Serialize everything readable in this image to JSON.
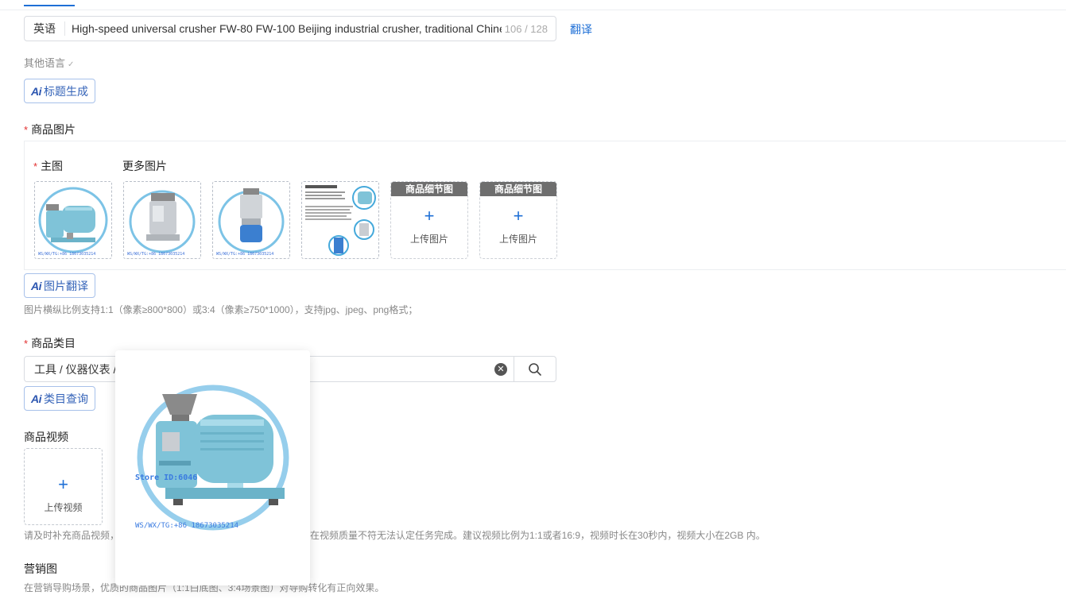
{
  "title_field": {
    "lang": "英语",
    "value": "High-speed universal crusher FW-80 FW-100 Beijing industrial crusher, traditional Chine",
    "count": "106 / 128",
    "translate": "翻译"
  },
  "other_lang": {
    "label": "其他语言"
  },
  "ai_title_btn": {
    "logo": "Ai",
    "label": "标题生成"
  },
  "images_section": {
    "label": "商品图片",
    "main_label": "主图",
    "more_label": "更多图片",
    "watermark": "WS/WX/TG:+86 18673035214",
    "slots": [
      {
        "head": "商品细节图",
        "text": "上传图片"
      },
      {
        "head": "商品细节图",
        "text": "上传图片"
      }
    ]
  },
  "ai_img_btn": {
    "logo": "Ai",
    "label": "图片翻译"
  },
  "img_hint": "图片横纵比例支持1:1（像素≥800*800）或3:4（像素≥750*1000），支持jpg、jpeg、png格式；",
  "category_section": {
    "label": "商品类目",
    "value": "工具 / 仪器仪表 /"
  },
  "ai_cat_btn": {
    "logo": "Ai",
    "label": "类目查询"
  },
  "video_section": {
    "label": "商品视频",
    "upload": "上传视频",
    "hint_left": "请及时补充商品视频，",
    "hint_right": "在视频质量不符无法认定任务完成。建议视频比例为1:1或者16:9，视频时长在30秒内，视频大小在2GB 内。"
  },
  "marketing_section": {
    "label": "营销图",
    "hint": "在营销导购场景，优质的商品图片（1:1白底图、3:4场景图）对导购转化有正向效果。"
  },
  "preview": {
    "store": "Store ID:6046",
    "watermark": "WS/WX/TG:+86 18673035214"
  },
  "colors": {
    "accent": "#1e6fd6",
    "machine": "#7fc3d8",
    "required": "#e23030"
  }
}
